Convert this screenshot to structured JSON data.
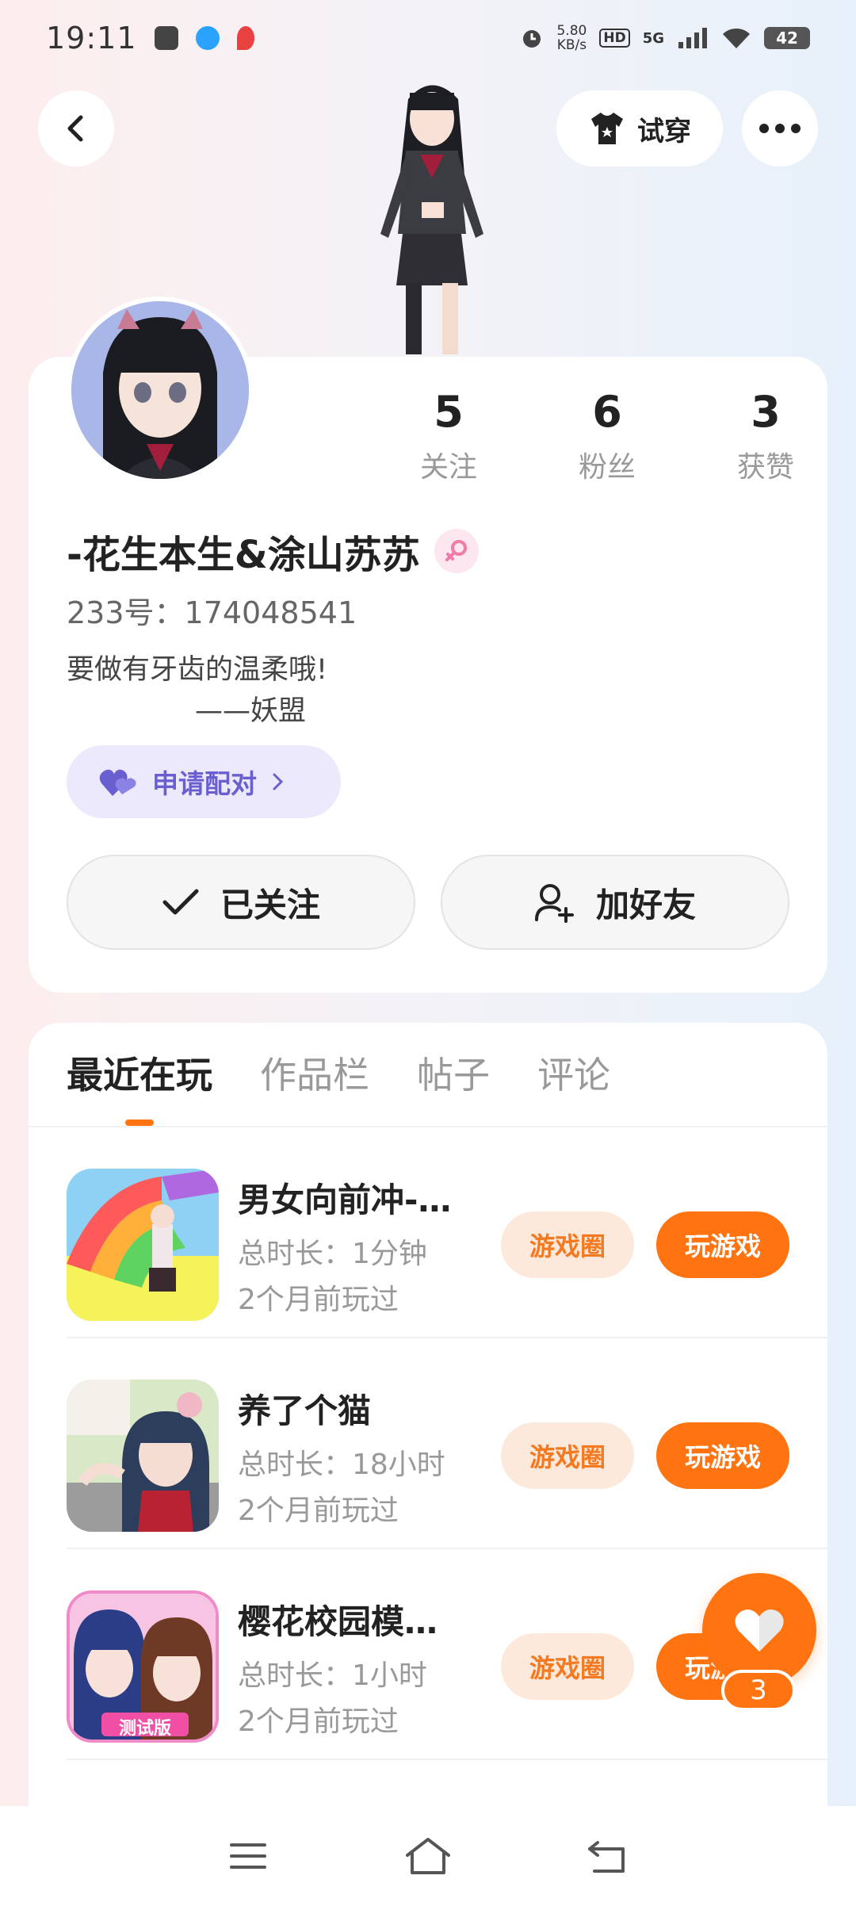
{
  "status_bar": {
    "time": "19:11",
    "speed_value": "5.80",
    "speed_unit": "KB/s",
    "hd": "HD",
    "network": "5G",
    "battery": "42"
  },
  "header": {
    "tryon_label": "试穿"
  },
  "profile": {
    "stats": [
      {
        "value": "5",
        "label": "关注"
      },
      {
        "value": "6",
        "label": "粉丝"
      },
      {
        "value": "3",
        "label": "获赞"
      }
    ],
    "username": "-花生本生&涂山苏苏",
    "uid": "233号：174048541",
    "bio_line1": "要做有牙齿的温柔哦!",
    "bio_line2": "——妖盟",
    "pair_label": "申请配对",
    "follow_label": "已关注",
    "add_friend_label": "加好友"
  },
  "tabs": [
    {
      "label": "最近在玩",
      "active": true
    },
    {
      "label": "作品栏",
      "active": false
    },
    {
      "label": "帖子",
      "active": false
    },
    {
      "label": "评论",
      "active": false
    }
  ],
  "games": [
    {
      "name": "男女向前冲-…",
      "duration": "总时长：1分钟",
      "last_played": "2个月前玩过",
      "circle_label": "游戏圈",
      "play_label": "玩游戏"
    },
    {
      "name": "养了个猫",
      "duration": "总时长：18小时",
      "last_played": "2个月前玩过",
      "circle_label": "游戏圈",
      "play_label": "玩游戏"
    },
    {
      "name": "樱花校园模…",
      "duration": "总时长：1小时",
      "last_played": "2个月前玩过",
      "circle_label": "游戏圈",
      "play_label": "玩游戏"
    }
  ],
  "game_icon_badge": "测试版",
  "fab": {
    "count": "3"
  },
  "colors": {
    "accent": "#ff7310",
    "pair": "#6a5fd1",
    "circle_bg": "#fde9dc"
  }
}
